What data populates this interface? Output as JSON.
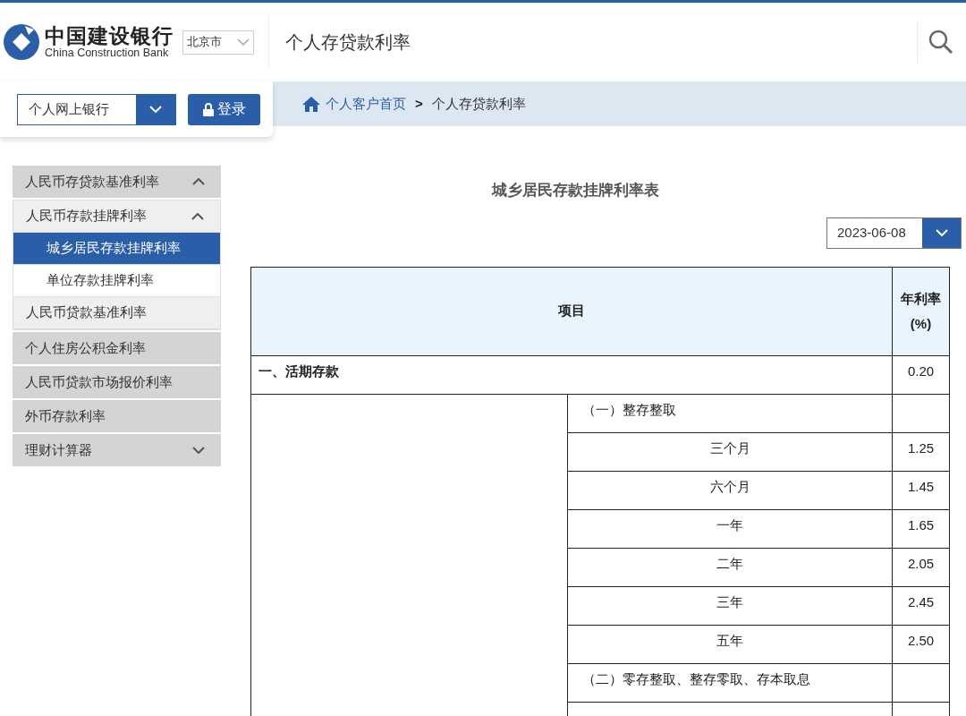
{
  "header": {
    "bank_name": "中国建设银行",
    "bank_name_en": "China Construction Bank",
    "region": "北京市",
    "page_title": "个人存贷款利率"
  },
  "toolbar": {
    "channel": "个人网上银行",
    "login": "登录"
  },
  "breadcrumb": [
    {
      "label": "个人客户首页",
      "kind": "link"
    },
    {
      "label": ">",
      "kind": "separator"
    },
    {
      "label": "个人存贷款利率",
      "kind": "current"
    }
  ],
  "sidebar": {
    "items": [
      {
        "label": "人民币存贷款基准利率",
        "expanded": true,
        "selected": false,
        "children": [
          {
            "label": "人民币存款挂牌利率",
            "expanded": true,
            "selected": false,
            "children": [
              {
                "label": "城乡居民存款挂牌利率",
                "selected": true
              },
              {
                "label": "单位存款挂牌利率",
                "selected": false
              }
            ]
          },
          {
            "label": "人民币贷款基准利率",
            "selected": false
          }
        ]
      },
      {
        "label": "个人住房公积金利率",
        "selected": false
      },
      {
        "label": "人民币贷款市场报价利率",
        "selected": false
      },
      {
        "label": "外币存款利率",
        "selected": false
      },
      {
        "label": "理财计算器",
        "expanded": false,
        "selected": false
      }
    ]
  },
  "content": {
    "title": "城乡居民存款挂牌利率表",
    "date": "2023-06-08",
    "table": {
      "columns": [
        "项目",
        "年利率(%)"
      ],
      "rows": [
        {
          "kind": "section",
          "item": "一、活期存款",
          "rate": "0.20"
        },
        {
          "kind": "subsection",
          "item": "（一）整存整取"
        },
        {
          "kind": "term",
          "item": "三个月",
          "rate": "1.25"
        },
        {
          "kind": "term",
          "item": "六个月",
          "rate": "1.45"
        },
        {
          "kind": "term",
          "item": "一年",
          "rate": "1.65"
        },
        {
          "kind": "term",
          "item": "二年",
          "rate": "2.05"
        },
        {
          "kind": "term",
          "item": "三年",
          "rate": "2.45"
        },
        {
          "kind": "term",
          "item": "五年",
          "rate": "2.50"
        },
        {
          "kind": "subsection",
          "item": "（二）零存整取、整存零取、存本取息"
        }
      ]
    }
  }
}
